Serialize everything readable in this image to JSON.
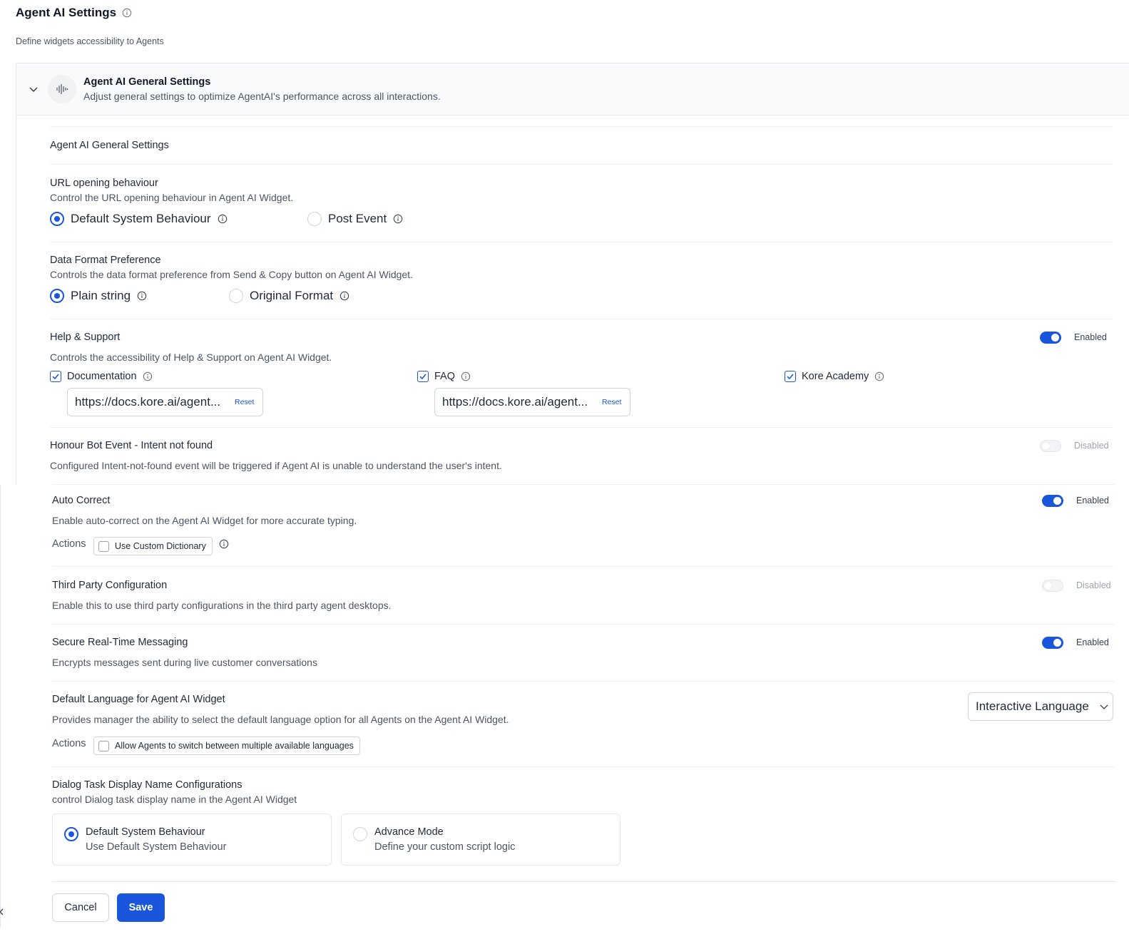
{
  "page": {
    "title": "Agent AI Settings",
    "subtitle": "Define widgets accessibility to Agents"
  },
  "panel": {
    "title": "Agent AI General Settings",
    "description": "Adjust general settings to optimize AgentAI's performance across all interactions.",
    "section_heading": "Agent AI General Settings",
    "icon": "waveform-icon"
  },
  "url_behaviour": {
    "title": "URL opening behaviour",
    "description": "Control the URL opening behaviour in Agent AI Widget.",
    "options": [
      "Default System Behaviour",
      "Post Event"
    ],
    "selected": "Default System Behaviour"
  },
  "data_format": {
    "title": "Data Format Preference",
    "description": "Controls the data format preference from Send & Copy button on Agent AI Widget.",
    "options": [
      "Plain string",
      "Original Format"
    ],
    "selected": "Plain string"
  },
  "help_support": {
    "title": "Help & Support",
    "description": "Controls the accessibility of Help & Support on Agent AI Widget.",
    "status": "Enabled",
    "items": [
      {
        "label": "Documentation",
        "checked": true,
        "url": "https://docs.kore.ai/agent...",
        "reset": "Reset"
      },
      {
        "label": "FAQ",
        "checked": true,
        "url": "https://docs.kore.ai/agent...",
        "reset": "Reset"
      },
      {
        "label": "Kore Academy",
        "checked": true
      }
    ]
  },
  "honour_bot": {
    "title": "Honour Bot Event - Intent not found",
    "description": "Configured Intent-not-found event will be triggered if Agent AI is unable to understand the user's intent.",
    "status": "Disabled"
  },
  "auto_correct": {
    "title": "Auto Correct",
    "description": "Enable auto-correct on the Agent AI Widget for more accurate typing.",
    "status": "Enabled",
    "actions_label": "Actions",
    "action": "Use Custom Dictionary"
  },
  "third_party": {
    "title": "Third Party Configuration",
    "description": "Enable this to use third party configurations in the third party agent desktops.",
    "status": "Disabled"
  },
  "secure_messaging": {
    "title": "Secure Real-Time Messaging",
    "description": "Encrypts messages sent during live customer conversations",
    "status": "Enabled"
  },
  "default_language": {
    "title": "Default Language for Agent AI Widget",
    "description": "Provides manager the ability to select the default language option for all Agents on the Agent AI Widget.",
    "selected": "Interactive Language",
    "actions_label": "Actions",
    "action": "Allow Agents to switch between multiple available languages"
  },
  "dialog_task": {
    "title": "Dialog Task Display Name Configurations",
    "description": "control Dialog task display name in the Agent AI Widget",
    "cards": [
      {
        "title": "Default System Behaviour",
        "description": "Use Default System Behaviour",
        "selected": true
      },
      {
        "title": "Advance Mode",
        "description": "Define your custom script logic",
        "selected": false
      }
    ]
  },
  "footer": {
    "cancel": "Cancel",
    "save": "Save"
  },
  "colors": {
    "accent": "#1a56db",
    "border": "#e5e7eb",
    "panel_bg": "#f9fafb"
  }
}
